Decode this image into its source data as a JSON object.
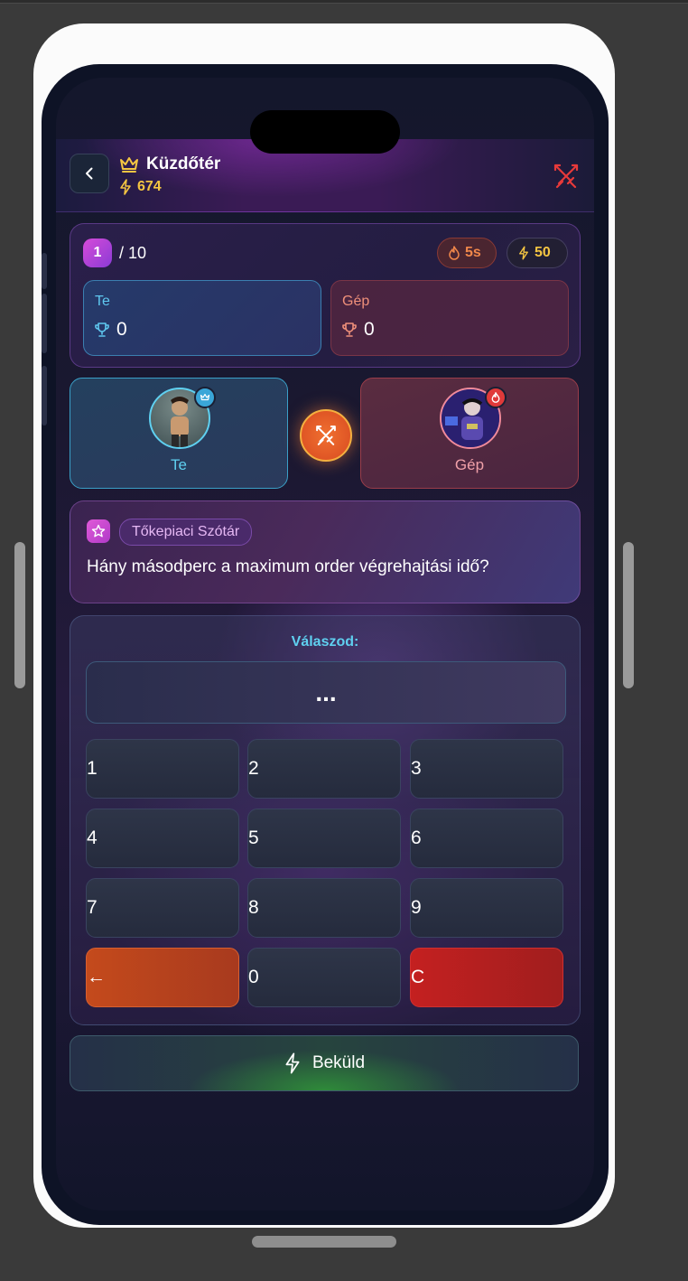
{
  "header": {
    "title": "Küzdőtér",
    "points": "674"
  },
  "round": {
    "current": "1",
    "total": "/ 10",
    "timer": "5s",
    "reward": "50"
  },
  "scores": {
    "you_label": "Te",
    "you_value": "0",
    "cpu_label": "Gép",
    "cpu_value": "0"
  },
  "players": {
    "you_name": "Te",
    "cpu_name": "Gép"
  },
  "question": {
    "category": "Tőkepiaci Szótár",
    "text": "Hány másodperc a maximum order végrehajtási idő?"
  },
  "answer": {
    "label": "Válaszod:",
    "value": "..."
  },
  "keypad": {
    "keys": [
      "1",
      "2",
      "3",
      "4",
      "5",
      "6",
      "7",
      "8",
      "9",
      "←",
      "0",
      "C"
    ]
  },
  "submit": {
    "label": "Beküld"
  },
  "colors": {
    "accent_gold": "#f4c542",
    "accent_cyan": "#5fd0f0",
    "accent_red": "#e03a3a",
    "backspace_orange": "#c44a1c",
    "clear_red": "#c42020"
  }
}
